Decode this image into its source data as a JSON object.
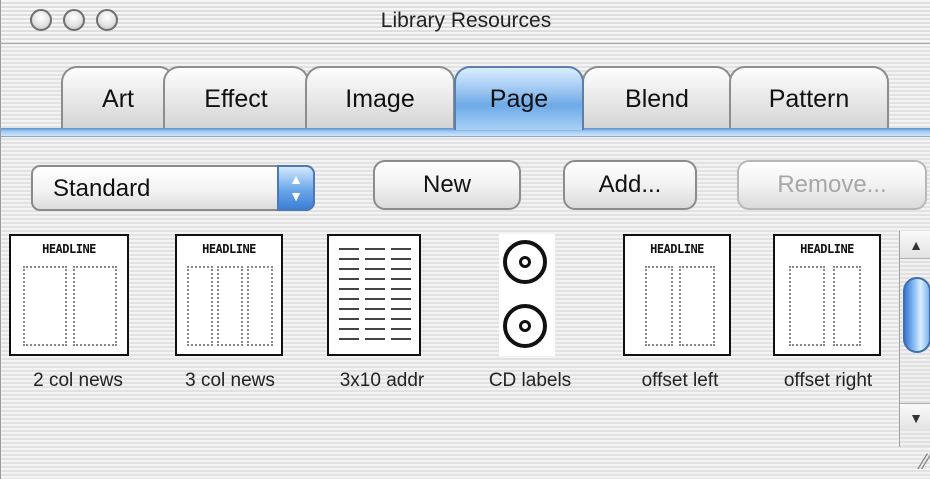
{
  "window": {
    "title": "Library Resources"
  },
  "tabs": [
    {
      "label": "Art",
      "active": false
    },
    {
      "label": "Effect",
      "active": false
    },
    {
      "label": "Image",
      "active": false
    },
    {
      "label": "Page",
      "active": true
    },
    {
      "label": "Blend",
      "active": false
    },
    {
      "label": "Pattern",
      "active": false
    }
  ],
  "toolbar": {
    "category_select_value": "Standard",
    "new_label": "New",
    "add_label": "Add...",
    "remove_label": "Remove...",
    "remove_enabled": false
  },
  "items": [
    {
      "label": "2 col news",
      "thumbnail_text": "HEADLINE",
      "icon": "two-column-newsletter-icon"
    },
    {
      "label": "3 col news",
      "thumbnail_text": "HEADLINE",
      "icon": "three-column-newsletter-icon"
    },
    {
      "label": "3x10 addr",
      "icon": "address-labels-icon"
    },
    {
      "label": "CD labels",
      "icon": "cd-labels-icon"
    },
    {
      "label": "offset left",
      "thumbnail_text": "HEADLINE",
      "icon": "offset-left-layout-icon"
    },
    {
      "label": "offset right",
      "thumbnail_text": "HEADLINE",
      "icon": "offset-right-layout-icon"
    }
  ],
  "scrollbar": {
    "up_glyph": "▲",
    "down_glyph": "▼"
  },
  "colors": {
    "active_tab": "#6ea9e7",
    "divider": "#5b8fd0",
    "disabled_text": "#a7a7a7"
  }
}
